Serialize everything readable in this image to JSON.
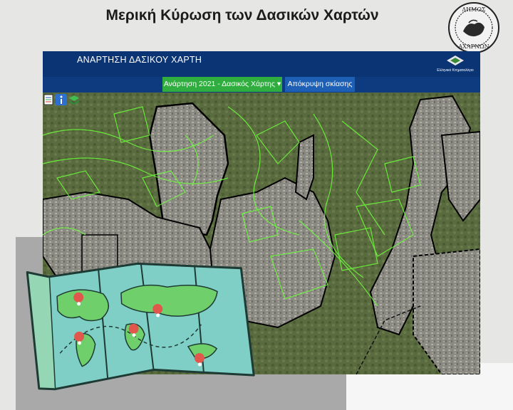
{
  "slide": {
    "title": "Μερική Κύρωση των Δασικών Χαρτών",
    "seal_text": "ΔΗΜΟΣ ΑΧΑΡΝΩΝ"
  },
  "app": {
    "title": "ΑΝΑΡΤΗΣΗ ΔΑΣΙΚΟΥ ΧΑΡΤΗ",
    "logo_caption": "Ελληνικό Κτηματολόγιο",
    "layer_dropdown": "Ανάρτηση 2021 - Δασικός Χάρτης ▾",
    "hide_shading_button": "Απόκρυψη σκίασης"
  },
  "toolbar": {
    "icons": [
      "legend-icon",
      "info-icon",
      "layers-icon"
    ]
  },
  "map": {
    "type": "satellite-imagery",
    "overlay_colors": {
      "forest_boundaries": "#6cff3a",
      "ratified_area_outline": "#000000"
    }
  },
  "illustration": {
    "icons": [
      "world-map-icon",
      "location-pin-icon"
    ]
  },
  "colors": {
    "header": "#0b3475",
    "dropdown": "#2fae3f",
    "button": "#1d5fb5"
  }
}
